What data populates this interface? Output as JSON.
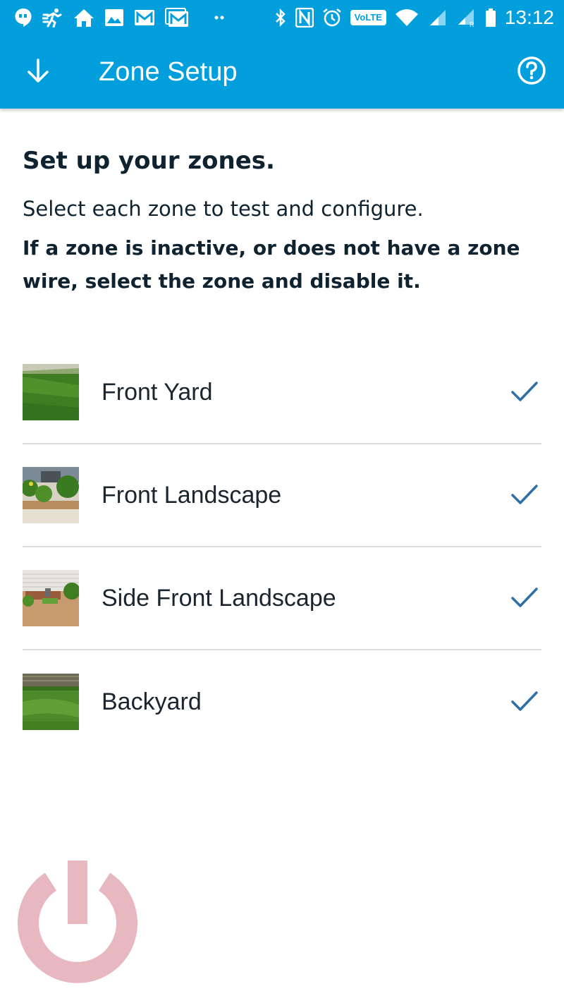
{
  "status_bar": {
    "time": "13:12",
    "volte_label": "VoLTE",
    "left_icons": [
      "hangouts-icon",
      "activity-icon",
      "home-icon",
      "photo-icon",
      "gmail-icon",
      "gmail-icon",
      "more-dots-icon"
    ],
    "right_icons": [
      "bluetooth-icon",
      "nfc-icon",
      "alarm-icon",
      "wifi-icon",
      "signal-icon",
      "signal-roaming-icon",
      "battery-icon"
    ]
  },
  "app_bar": {
    "title": "Zone Setup",
    "back_icon": "arrow-down-icon",
    "help_icon": "help-circle-icon"
  },
  "content": {
    "heading": "Set up your zones.",
    "instruction": "Select each zone to test and configure.",
    "warning": "If a zone is inactive, or does not have a zone wire, select the zone and disable it."
  },
  "zones": [
    {
      "label": "Front Yard",
      "checked": true,
      "thumb": "lawn"
    },
    {
      "label": "Front Landscape",
      "checked": true,
      "thumb": "shrubs"
    },
    {
      "label": "Side Front Landscape",
      "checked": true,
      "thumb": "side-bed"
    },
    {
      "label": "Backyard",
      "checked": true,
      "thumb": "backyard-lawn"
    }
  ],
  "colors": {
    "primary": "#029fdc",
    "check": "#2e6fa6",
    "divider": "#dcdcdc",
    "logo": "#e8b8c0"
  }
}
